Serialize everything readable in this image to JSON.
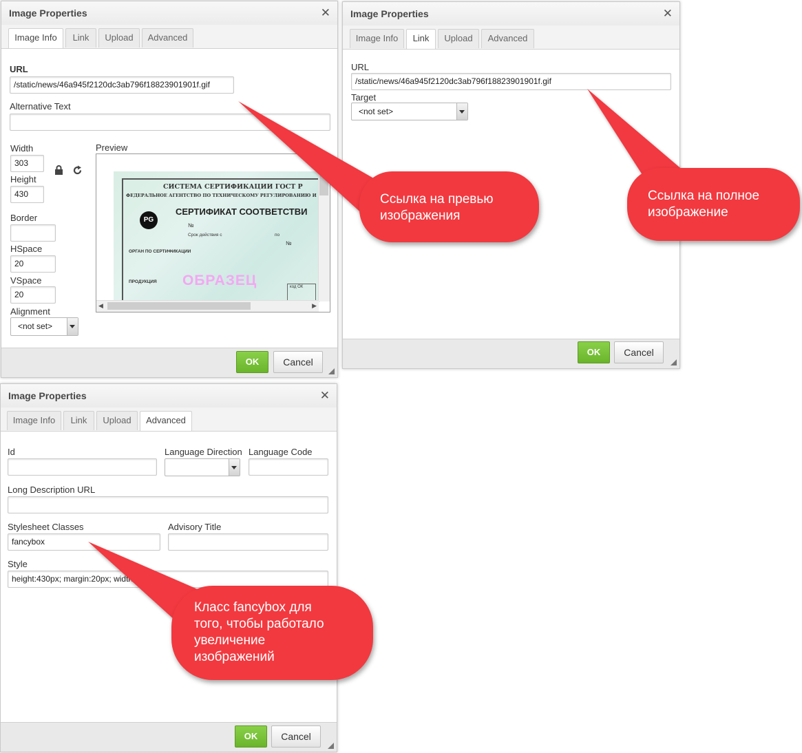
{
  "dialog1": {
    "title": "Image Properties",
    "tabs": [
      "Image Info",
      "Link",
      "Upload",
      "Advanced"
    ],
    "url_label": "URL",
    "url_value": "/static/news/46a945f2120dc3ab796f18823901901f.gif",
    "alt_label": "Alternative Text",
    "alt_value": "",
    "width_label": "Width",
    "width_value": "303",
    "height_label": "Height",
    "height_value": "430",
    "border_label": "Border",
    "border_value": "",
    "hspace_label": "HSpace",
    "hspace_value": "20",
    "vspace_label": "VSpace",
    "vspace_value": "20",
    "alignment_label": "Alignment",
    "alignment_value": "<not set>",
    "preview_label": "Preview",
    "preview": {
      "line1": "СИСТЕМА СЕРТИФИКАЦИИ ГОСТ Р",
      "line2": "ФЕДЕРАЛЬНОЕ АГЕНТСТВО ПО ТЕХНИЧЕСКОМУ РЕГУЛИРОВАНИЮ И МЕТРО",
      "heading": "СЕРТИФИКАТ СООТВЕТСТВИ",
      "field1": "Срок действия с",
      "field2": "по",
      "field3": "ОРГАН ПО СЕРТИФИКАЦИИ",
      "field4": "ПРОДУКЦИЯ",
      "no1": "№",
      "no2": "№",
      "stamp": "ОБРАЗЕЦ",
      "code": "код ОК",
      "logo_text": "PG"
    },
    "ok": "OK",
    "cancel": "Cancel"
  },
  "dialog2": {
    "title": "Image Properties",
    "tabs": [
      "Image Info",
      "Link",
      "Upload",
      "Advanced"
    ],
    "url_label": "URL",
    "url_value": "/static/news/46a945f2120dc3ab796f18823901901f.gif",
    "target_label": "Target",
    "target_value": "<not set>",
    "ok": "OK",
    "cancel": "Cancel"
  },
  "dialog3": {
    "title": "Image Properties",
    "tabs": [
      "Image Info",
      "Link",
      "Upload",
      "Advanced"
    ],
    "id_label": "Id",
    "id_value": "",
    "lang_dir_label": "Language Direction",
    "lang_dir_value": "",
    "lang_code_label": "Language Code",
    "lang_code_value": "",
    "longdesc_label": "Long Description URL",
    "longdesc_value": "",
    "classes_label": "Stylesheet Classes",
    "classes_value": "fancybox",
    "advisory_label": "Advisory Title",
    "advisory_value": "",
    "style_label": "Style",
    "style_value": "height:430px; margin:20px; width:303px",
    "ok": "OK",
    "cancel": "Cancel"
  },
  "callouts": {
    "preview_link": [
      "Ссылка на превью",
      "изображения"
    ],
    "full_link": [
      "Ссылка на полное",
      "изображение"
    ],
    "fancybox": [
      "Класс fancybox для",
      "того, чтобы работало",
      "увеличение",
      "изображений"
    ]
  },
  "colors": {
    "callout": "#f2393f",
    "ok_button": "#7cc13a",
    "dialog_border": "#c9c9c9"
  },
  "icons": {
    "close": "close-icon",
    "lock": "lock-icon",
    "reset": "reset-size-icon",
    "resize": "resize-grip-icon"
  }
}
